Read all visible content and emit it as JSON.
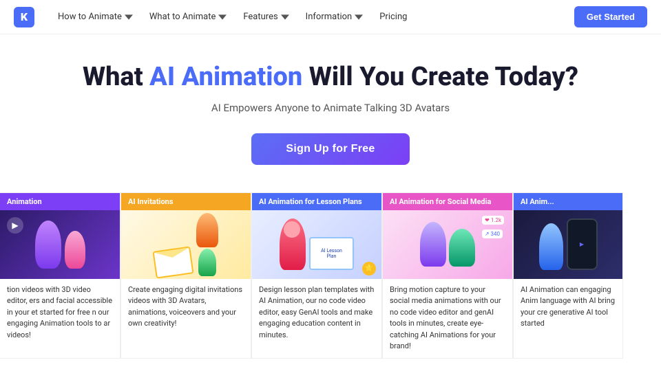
{
  "nav": {
    "logo_letter": "K",
    "links": [
      {
        "label": "How to Animate",
        "has_arrow": true
      },
      {
        "label": "What to Animate",
        "has_arrow": true
      },
      {
        "label": "Features",
        "has_arrow": true
      },
      {
        "label": "Information",
        "has_arrow": true
      },
      {
        "label": "Pricing",
        "has_arrow": false
      }
    ],
    "cta_label": "Get Started"
  },
  "hero": {
    "title_before": "What ",
    "title_highlight": "AI Animation",
    "title_after": " Will You Create Today?",
    "subtitle": "AI Empowers Anyone to Animate Talking 3D Avatars",
    "cta_label": "Sign Up for Free"
  },
  "cards": [
    {
      "id": 1,
      "header": "Animation",
      "partial_left": true,
      "description": "tion videos with 3D video editor, ers and facial accessible in your et started for free n our engaging Animation tools to ar videos!"
    },
    {
      "id": 2,
      "header": "AI Invitations",
      "description": "Create engaging digital invitations videos with 3D Avatars, animations, voiceovers and your own creativity!"
    },
    {
      "id": 3,
      "header": "AI Animation for Lesson Plans",
      "description": "Design lesson plan templates with AI Animation, our no code video editor, easy GenAI tools and make engaging education content in minutes."
    },
    {
      "id": 4,
      "header": "AI Animation for Social Media",
      "description": "Bring motion capture to your social media animations with our no code video editor and genAI tools in minutes, create eye-catching AI Animations for your brand!"
    },
    {
      "id": 5,
      "header": "AI Anim...",
      "partial_right": true,
      "description": "AI Animation can engaging Anim language with AI bring your cre generative AI tool started"
    }
  ]
}
